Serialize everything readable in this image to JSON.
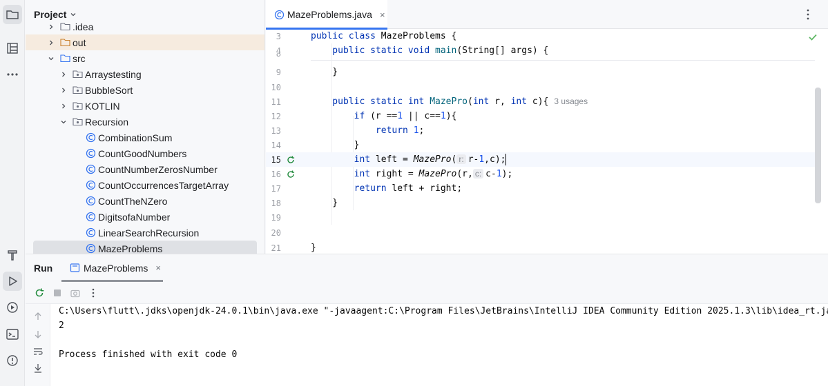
{
  "colors": {
    "accent": "#3574f0",
    "keyword": "#0033b3",
    "method": "#00627a",
    "number": "#1750eb",
    "success": "#5fb865"
  },
  "toolwindow_strip": {
    "top": [
      "folder-icon",
      "structure-icon",
      "more-icon"
    ],
    "bottom": [
      "build-hammer-icon",
      "run-icon",
      "services-icon",
      "terminal-icon",
      "problems-icon"
    ]
  },
  "project": {
    "title": "Project",
    "tree": [
      {
        "label": ".idea",
        "type": "folder",
        "expanded": false
      },
      {
        "label": "out",
        "type": "folder",
        "expanded": false
      },
      {
        "label": "src",
        "type": "source-folder",
        "expanded": true
      },
      {
        "label": "Arraystesting",
        "type": "package",
        "expanded": false
      },
      {
        "label": "BubbleSort",
        "type": "package",
        "expanded": false
      },
      {
        "label": "KOTLIN",
        "type": "package",
        "expanded": false
      },
      {
        "label": "Recursion",
        "type": "package",
        "expanded": true
      },
      {
        "label": "CombinationSum",
        "type": "class"
      },
      {
        "label": "CountGoodNumbers",
        "type": "class"
      },
      {
        "label": "CountNumberZerosNumber",
        "type": "class"
      },
      {
        "label": "CountOccurrencesTargetArray",
        "type": "class"
      },
      {
        "label": "CountTheNZero",
        "type": "class"
      },
      {
        "label": "DigitsofaNumber",
        "type": "class"
      },
      {
        "label": "LinearSearchRecursion",
        "type": "class"
      },
      {
        "label": "MazeProblems",
        "type": "class",
        "selected": true
      }
    ]
  },
  "editor": {
    "tab_label": "MazeProblems.java",
    "tab_close": "×",
    "lines": {
      "l3": {
        "num": "3",
        "t1": "public class ",
        "t2": "MazeProblems {"
      },
      "l4": {
        "num": "4",
        "t1": "    public static void ",
        "t2": "main",
        "t3": "(String[] args) {"
      },
      "l8": {
        "num": "8"
      },
      "l9": {
        "num": "9",
        "t1": "    }"
      },
      "l10": {
        "num": "10"
      },
      "l11": {
        "num": "11",
        "t1": "    public static int ",
        "t2": "MazePro",
        "t3": "(",
        "t4": "int ",
        "t5": "r, ",
        "t6": "int ",
        "t7": "c){",
        "usage": "3 usages"
      },
      "l12": {
        "num": "12",
        "t1": "        if ",
        "t2": "(r ==",
        "t3": "1",
        "t4": " || c==",
        "t5": "1",
        "t6": "){"
      },
      "l13": {
        "num": "13",
        "t1": "            return ",
        "t2": "1",
        "t3": ";"
      },
      "l14": {
        "num": "14",
        "t1": "        }"
      },
      "l15": {
        "num": "15",
        "t1": "        int ",
        "t2": "left = ",
        "t3": "MazePro",
        "t4": "(",
        "hint": "r:",
        "t5": "r-",
        "t6": "1",
        "t7": ",c);"
      },
      "l16": {
        "num": "16",
        "t1": "        int ",
        "t2": "right = ",
        "t3": "MazePro",
        "t4": "(r,",
        "hint": "c:",
        "t5": "c-",
        "t6": "1",
        "t7": ");"
      },
      "l17": {
        "num": "17",
        "t1": "        return ",
        "t2": "left + right;"
      },
      "l18": {
        "num": "18",
        "t1": "    }"
      },
      "l19": {
        "num": "19"
      },
      "l20": {
        "num": "20"
      },
      "l21": {
        "num": "21",
        "t1": "}"
      }
    }
  },
  "run": {
    "title": "Run",
    "tab_label": "MazeProblems",
    "tab_close": "×",
    "console": [
      "C:\\Users\\flutt\\.jdks\\openjdk-24.0.1\\bin\\java.exe \"-javaagent:C:\\Program Files\\JetBrains\\IntelliJ IDEA Community Edition 2025.1.3\\lib\\idea_rt.jar",
      "2",
      "",
      "Process finished with exit code 0"
    ]
  }
}
